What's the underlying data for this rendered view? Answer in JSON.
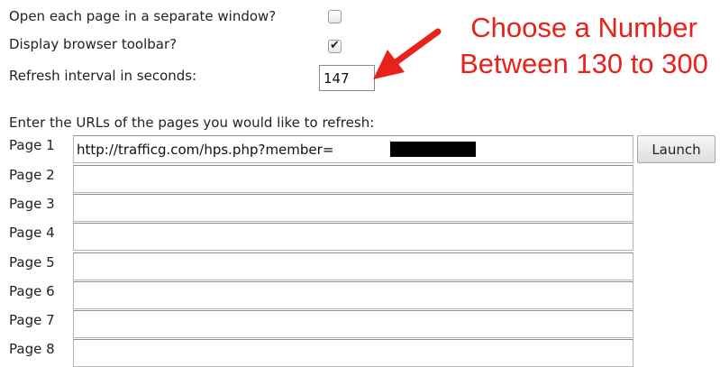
{
  "options": {
    "separate_window_label": "Open each page in a separate window?",
    "separate_window_checked": false,
    "toolbar_label": "Display browser toolbar?",
    "toolbar_checked": true,
    "refresh_label": "Refresh interval in seconds:",
    "refresh_value": "147"
  },
  "annotation": {
    "line1": "Choose a Number",
    "line2": "Between 130 to 300",
    "color": "#e8221b"
  },
  "urls": {
    "heading": "Enter the URLs of the pages you would like to refresh:",
    "launch_label": "Launch",
    "pages": [
      {
        "label": "Page 1",
        "value": "http://trafficg.com/hps.php?member="
      },
      {
        "label": "Page 2",
        "value": ""
      },
      {
        "label": "Page 3",
        "value": ""
      },
      {
        "label": "Page 4",
        "value": ""
      },
      {
        "label": "Page 5",
        "value": ""
      },
      {
        "label": "Page 6",
        "value": ""
      },
      {
        "label": "Page 7",
        "value": ""
      },
      {
        "label": "Page 8",
        "value": ""
      }
    ]
  }
}
